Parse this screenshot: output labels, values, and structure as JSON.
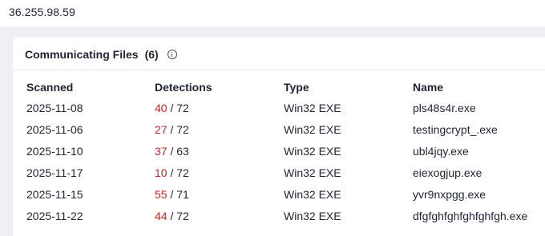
{
  "ip_address": "36.255.98.59",
  "section": {
    "title": "Communicating Files",
    "count": "(6)",
    "info_icon": "info-circle-icon"
  },
  "table": {
    "headers": [
      "Scanned",
      "Detections",
      "Type",
      "Name"
    ],
    "rows": [
      {
        "scanned": "2025-11-08",
        "detections": "40",
        "total": "/ 72",
        "type": "Win32 EXE",
        "name": "pls48s4r.exe"
      },
      {
        "scanned": "2025-11-06",
        "detections": "27",
        "total": "/ 72",
        "type": "Win32 EXE",
        "name": "testingcrypt_.exe"
      },
      {
        "scanned": "2025-11-10",
        "detections": "37",
        "total": "/ 63",
        "type": "Win32 EXE",
        "name": "ubl4jqy.exe"
      },
      {
        "scanned": "2025-11-17",
        "detections": "10",
        "total": "/ 72",
        "type": "Win32 EXE",
        "name": "eiexogjup.exe"
      },
      {
        "scanned": "2025-11-15",
        "detections": "55",
        "total": "/ 71",
        "type": "Win32 EXE",
        "name": "yvr9nxpgg.exe"
      },
      {
        "scanned": "2025-11-22",
        "detections": "44",
        "total": "/ 72",
        "type": "Win32 EXE",
        "name": "dfgfghfghfghfghfgh.exe"
      }
    ]
  },
  "colors": {
    "detection_count": "#c62828",
    "page_background": "#eef0f6",
    "card_background": "#ffffff"
  }
}
